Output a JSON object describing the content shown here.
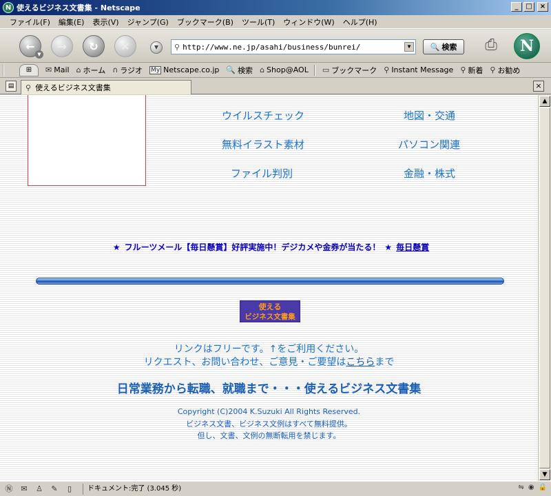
{
  "window": {
    "title": "使えるビジネス文書集 - Netscape",
    "minimize": "_",
    "maximize": "□",
    "close": "×"
  },
  "menu": [
    "ファイル(F)",
    "編集(E)",
    "表示(V)",
    "ジャンプ(G)",
    "ブックマーク(B)",
    "ツール(T)",
    "ウィンドウ(W)",
    "ヘルプ(H)"
  ],
  "toolbar": {
    "url": "http://www.ne.jp/asahi/business/bunrei/",
    "search_label": "検索"
  },
  "personal_toolbar": {
    "items": [
      "Mail",
      "ホーム",
      "ラジオ",
      "Netscape.co.jp",
      "検索",
      "Shop@AOL",
      "ブックマーク",
      "Instant Message",
      "新着",
      "お勧め"
    ]
  },
  "tab": {
    "title": "使えるビジネス文書集"
  },
  "content": {
    "links_left": [
      "ウイルスチェック",
      "無料イラスト素材",
      "ファイル判別"
    ],
    "links_right": [
      "地図・交通",
      "パソコン関連",
      "金融・株式"
    ],
    "promo": {
      "star": "★",
      "text": "フルーツメール【毎日懸賞】好評実施中！デジカメや金券が当たる！",
      "link": "毎日懸賞"
    },
    "logo": {
      "line1": "使える",
      "line2": "ビジネス文書集"
    },
    "notice1": "リンクはフリーです。↑をご利用ください。",
    "notice2_prefix": "リクエスト、お問い合わせ、ご意見・ご要望は",
    "notice2_link": "こちら",
    "notice2_suffix": "まで",
    "slogan": "日常業務から転職、就職まで・・・使えるビジネス文書集",
    "copyright": "Copyright (C)2004 K.Suzuki All Rights Reserved.",
    "free_notice": "ビジネス文書、ビジネス文例はすべて無料提供。",
    "prohibit": "但し、文書、文例の無断転用を禁じます。"
  },
  "status": {
    "text": "ドキュメント:完了 (3.045 秒)"
  }
}
